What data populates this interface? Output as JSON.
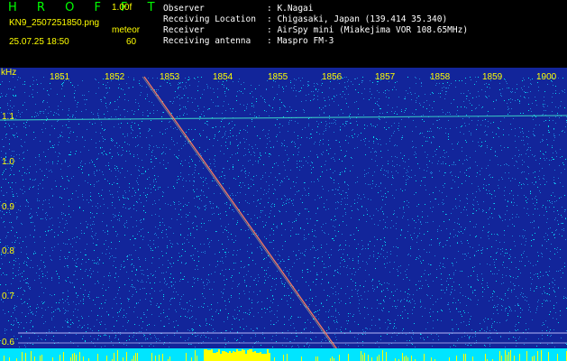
{
  "header": {
    "logo": "H R O F F T",
    "version": "1.00f",
    "filename": "KN9_2507251850.png",
    "stream_label": "meteor",
    "timestamp": "25.07.25 18:50",
    "count": "60",
    "info": [
      {
        "key": "Observer",
        "value": ": K.Nagai"
      },
      {
        "key": "Receiving Location",
        "value": ": Chigasaki, Japan (139.414 35.340)"
      },
      {
        "key": "Receiver",
        "value": ": AirSpy mini (Miakejima VOR 108.65MHz)"
      },
      {
        "key": "Receiving antenna",
        "value": ": Maspro FM-3"
      }
    ]
  },
  "axis": {
    "unit": "kHz",
    "time_ticks": [
      "1851",
      "1852",
      "1853",
      "1854",
      "1855",
      "1856",
      "1857",
      "1858",
      "1859",
      "1900"
    ],
    "freq_ticks": [
      "1.1",
      "1.0",
      "0.9",
      "0.8",
      "0.7",
      "0.6"
    ]
  },
  "colors": {
    "background": "#000000",
    "spectrum_bg": "#12259a",
    "noise": "#00ffff",
    "accent": "#ffff00",
    "text": "#ffffff"
  }
}
